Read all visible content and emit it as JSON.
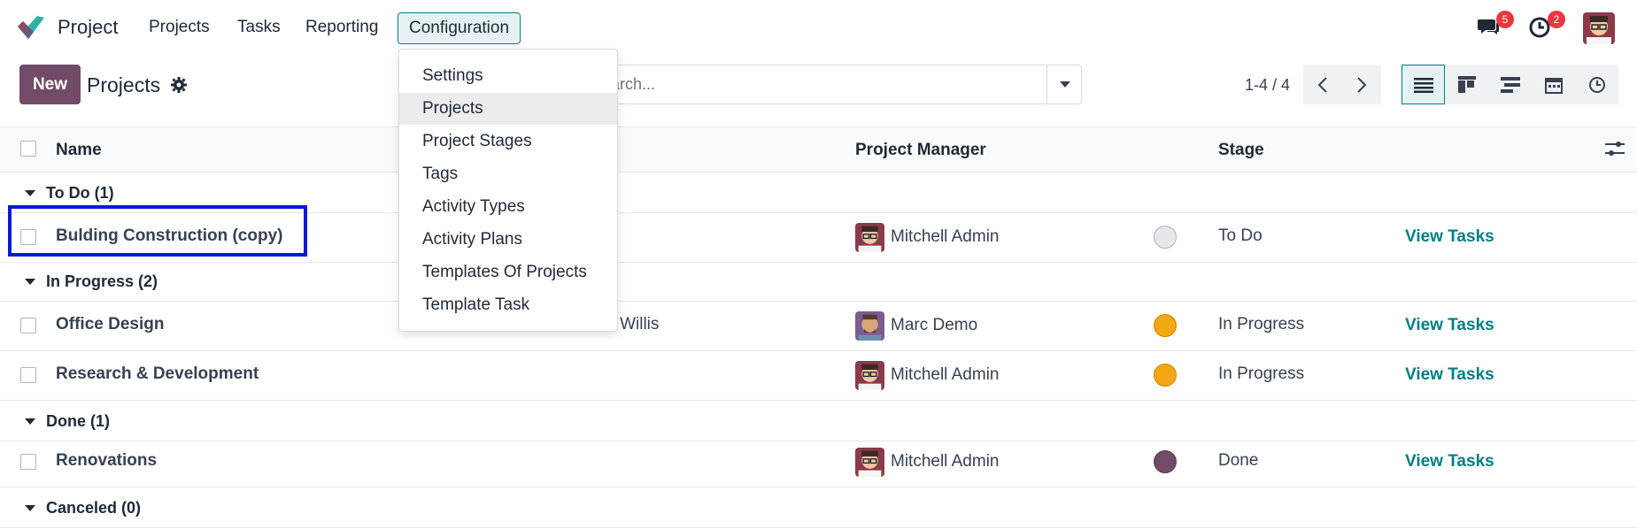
{
  "nav": {
    "app_name": "Project",
    "menu": [
      "Projects",
      "Tasks",
      "Reporting",
      "Configuration"
    ],
    "messages_badge": "5",
    "activities_badge": "2"
  },
  "control": {
    "new_label": "New",
    "title": "Projects",
    "search_placeholder": "Search...",
    "search_visible": "arch...",
    "pager": "1-4 / 4"
  },
  "table": {
    "headers": {
      "name": "Name",
      "manager": "Project Manager",
      "stage": "Stage"
    },
    "groups": [
      {
        "label": "To Do (1)"
      },
      {
        "label": "In Progress (2)"
      },
      {
        "label": "Done (1)"
      },
      {
        "label": "Canceled (0)"
      }
    ],
    "rows": [
      {
        "name": "Bulding Construction (copy)",
        "manager": "Mitchell Admin",
        "stage": "To Do",
        "status_color": "#e5e7eb",
        "action": "View Tasks"
      },
      {
        "name": "Office Design",
        "customer_partial": "el Willis",
        "manager": "Marc Demo",
        "stage": "In Progress",
        "status_color": "#f3a712",
        "action": "View Tasks"
      },
      {
        "name": "Research & Development",
        "manager": "Mitchell Admin",
        "stage": "In Progress",
        "status_color": "#f3a712",
        "action": "View Tasks"
      },
      {
        "name": "Renovations",
        "manager": "Mitchell Admin",
        "stage": "Done",
        "status_color": "#714b67",
        "action": "View Tasks"
      }
    ]
  },
  "dropdown": {
    "items": [
      "Settings",
      "Projects",
      "Project Stages",
      "Tags",
      "Activity Types",
      "Activity Plans",
      "Templates Of Projects",
      "Template Task"
    ],
    "active_index": 1
  },
  "colors": {
    "brand": "#714b67",
    "accent": "#017e84",
    "highlight": "#0019d9"
  }
}
